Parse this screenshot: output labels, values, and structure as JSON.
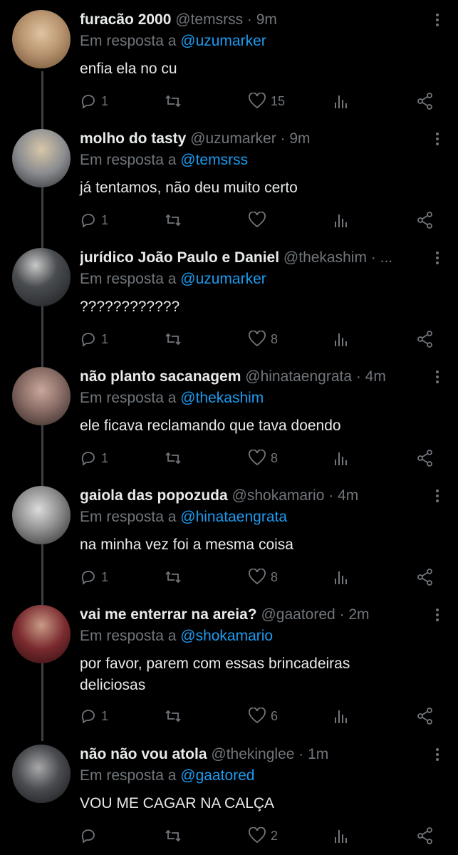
{
  "reply_prefix": "Em resposta a",
  "tweets": [
    {
      "name": "furacão 2000",
      "handle": "@temsrss · 9m",
      "reply_to": "@uzumarker",
      "text": "enfia ela no cu",
      "replies": "1",
      "likes": "15",
      "avatar_color": "#b89570"
    },
    {
      "name": "molho do tasty",
      "handle": "@uzumarker · 9m",
      "reply_to": "@temsrss",
      "text": "já tentamos, não deu muito certo",
      "replies": "1",
      "likes": "",
      "avatar_color": "#6e7480"
    },
    {
      "name": "jurídico João Paulo e Daniel",
      "handle": "@thekashim · ...",
      "reply_to": "@uzumarker",
      "text": "????????????",
      "replies": "1",
      "likes": "8",
      "avatar_color": "#3a3d40"
    },
    {
      "name": "não planto sacanagem",
      "handle": "@hinataengrata · 4m",
      "reply_to": "@thekashim",
      "text": "ele ficava reclamando que tava doendo",
      "replies": "1",
      "likes": "8",
      "avatar_color": "#8a6d66"
    },
    {
      "name": "gaiola das popozuda",
      "handle": "@shokamario · 4m",
      "reply_to": "@hinataengrata",
      "text": "na minha vez foi a mesma coisa",
      "replies": "1",
      "likes": "8",
      "avatar_color": "#8f8f8f"
    },
    {
      "name": "vai me enterrar na areia?",
      "handle": "@gaatored · 2m",
      "reply_to": "@shokamario",
      "text": "por favor, parem com essas brincadeiras deliciosas",
      "replies": "1",
      "likes": "6",
      "avatar_color": "#7a2a2e"
    },
    {
      "name": "não não vou atola",
      "handle": "@thekinglee · 1m",
      "reply_to": "@gaatored",
      "text": "VOU ME CAGAR NA CALÇA",
      "replies": "",
      "likes": "2",
      "avatar_color": "#4a4c50"
    }
  ],
  "icons": {
    "reply": "reply-icon",
    "retweet": "retweet-icon",
    "like": "heart-icon",
    "analytics": "analytics-icon",
    "share": "share-icon",
    "more": "more-icon"
  },
  "colors": {
    "background": "#000000",
    "text": "#e7e9ea",
    "muted": "#71767b",
    "link": "#1d9bf0"
  }
}
